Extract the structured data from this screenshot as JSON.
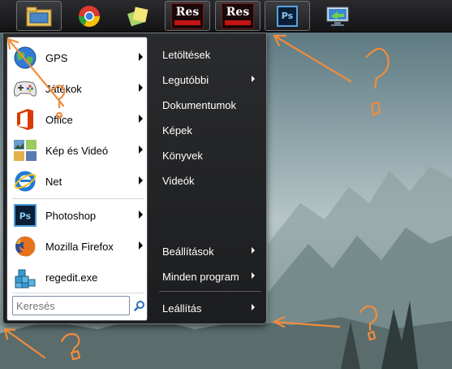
{
  "taskbar": {
    "pinned": [
      {
        "name": "file-explorer-icon"
      },
      {
        "name": "chrome-icon"
      },
      {
        "name": "sticky-notes-icon"
      },
      {
        "name": "res-hacker-icon",
        "label": "Res"
      },
      {
        "name": "res-hacker-icon-2",
        "label": "Res"
      },
      {
        "name": "photoshop-icon",
        "label": "Ps"
      },
      {
        "name": "remote-desktop-icon"
      }
    ]
  },
  "start_menu": {
    "programs": [
      {
        "label": "GPS",
        "icon": "globe-icon",
        "has_arrow": true
      },
      {
        "label": "Játékok",
        "icon": "gamepad-icon",
        "has_arrow": true
      },
      {
        "label": "Office",
        "icon": "office-icon",
        "has_arrow": true
      },
      {
        "label": "Kép és Videó",
        "icon": "photos-icon",
        "has_arrow": true
      },
      {
        "label": "Net",
        "icon": "internet-explorer-icon",
        "has_arrow": true
      },
      {
        "label": "Photoshop",
        "icon": "photoshop-icon",
        "has_arrow": true
      },
      {
        "label": "Mozilla Firefox",
        "icon": "firefox-icon",
        "has_arrow": true
      },
      {
        "label": "regedit.exe",
        "icon": "regedit-icon",
        "has_arrow": false
      }
    ],
    "search": {
      "placeholder": "Keresés"
    },
    "right_items": [
      {
        "label": "Letöltések",
        "has_arrow": false
      },
      {
        "label": "Legutóbbi",
        "has_arrow": true
      },
      {
        "label": "Dokumentumok",
        "has_arrow": false
      },
      {
        "label": "Képek",
        "has_arrow": false
      },
      {
        "label": "Könyvek",
        "has_arrow": false
      },
      {
        "label": "Videók",
        "has_arrow": false
      },
      {
        "label": "Beállítások",
        "has_arrow": true
      },
      {
        "label": "Minden program",
        "has_arrow": true
      },
      {
        "label": "Leállítás",
        "has_arrow": true
      }
    ]
  },
  "annotations": {
    "color": "#f08c3c",
    "marks": [
      "?",
      "?",
      "?",
      "?"
    ]
  }
}
